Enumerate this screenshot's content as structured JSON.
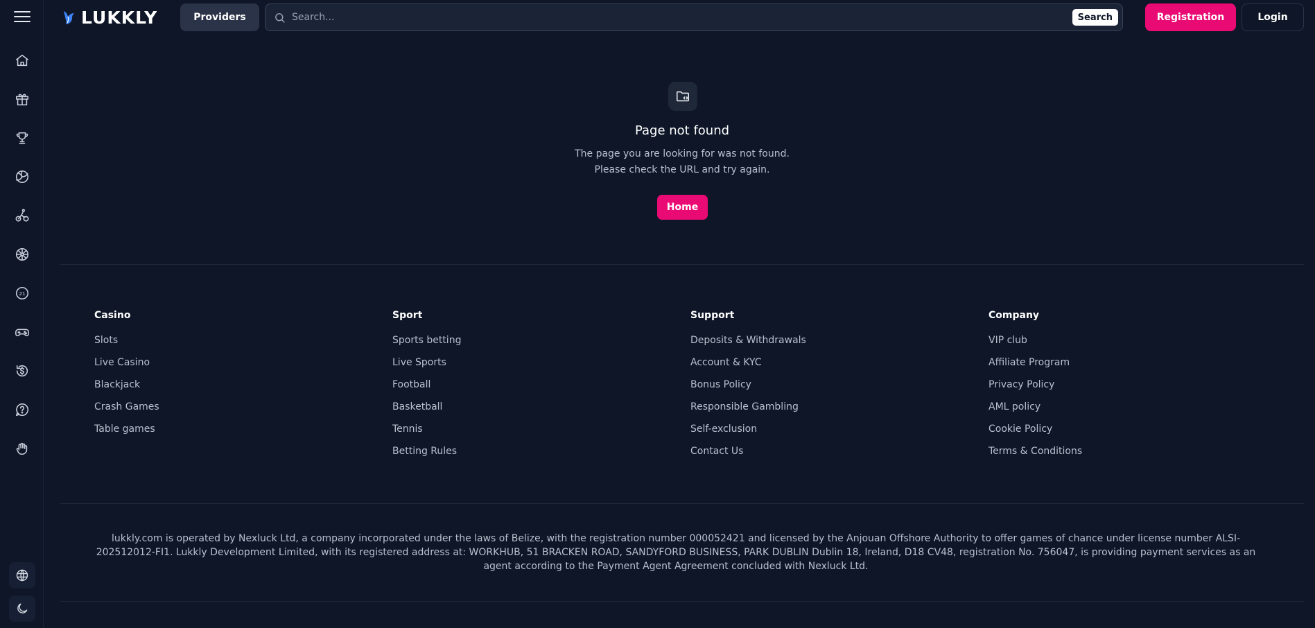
{
  "header": {
    "logo_text": "LUKKLY",
    "providers_label": "Providers",
    "search_placeholder": "Search...",
    "search_button": "Search",
    "registration_label": "Registration",
    "login_label": "Login"
  },
  "sidebar": {
    "items": [
      {
        "icon": "home-icon"
      },
      {
        "icon": "gift-icon"
      },
      {
        "icon": "trophy-icon"
      },
      {
        "icon": "volleyball-icon"
      },
      {
        "icon": "cycling-icon"
      },
      {
        "icon": "wheel-icon"
      },
      {
        "icon": "blackjack-21-icon"
      },
      {
        "icon": "gamepad-icon"
      },
      {
        "icon": "cashback-icon"
      },
      {
        "icon": "help-icon"
      },
      {
        "icon": "hand-icon"
      }
    ],
    "bottom": [
      {
        "icon": "globe-icon"
      },
      {
        "icon": "moon-icon"
      }
    ]
  },
  "not_found": {
    "title": "Page not found",
    "description": "The page you are looking for was not found. Please check the URL and try again.",
    "home_label": "Home"
  },
  "footer": {
    "columns": [
      {
        "title": "Casino",
        "links": [
          "Slots",
          "Live Casino",
          "Blackjack",
          "Crash Games",
          "Table games"
        ]
      },
      {
        "title": "Sport",
        "links": [
          "Sports betting",
          "Live Sports",
          "Football",
          "Basketball",
          "Tennis",
          "Betting Rules"
        ]
      },
      {
        "title": "Support",
        "links": [
          "Deposits & Withdrawals",
          "Account & KYC",
          "Bonus Policy",
          "Responsible Gambling",
          "Self-exclusion",
          "Contact Us"
        ]
      },
      {
        "title": "Company",
        "links": [
          "VIP club",
          "Affiliate Program",
          "Privacy Policy",
          "AML policy",
          "Cookie Policy",
          "Terms & Conditions"
        ]
      }
    ],
    "legal": "lukkly.com is operated by Nexluck Ltd, a company incorporated under the laws of Belize, with the registration number 000052421 and licensed by the Anjouan Offshore Authority to offer games of chance under license number ALSI-202512012-FI1. Lukkly Development Limited, with its registered address at: WORKHUB, 51 BRACKEN ROAD, SANDYFORD BUSINESS, PARK DUBLIN Dublin 18, Ireland, D18 CV48, registration No. 756047, is providing payment services as an agent according to the Payment Agent Agreement concluded with Nexluck Ltd."
  },
  "colors": {
    "background": "#0e1628",
    "accent": "#ea0a73",
    "panel": "#2a3347"
  }
}
